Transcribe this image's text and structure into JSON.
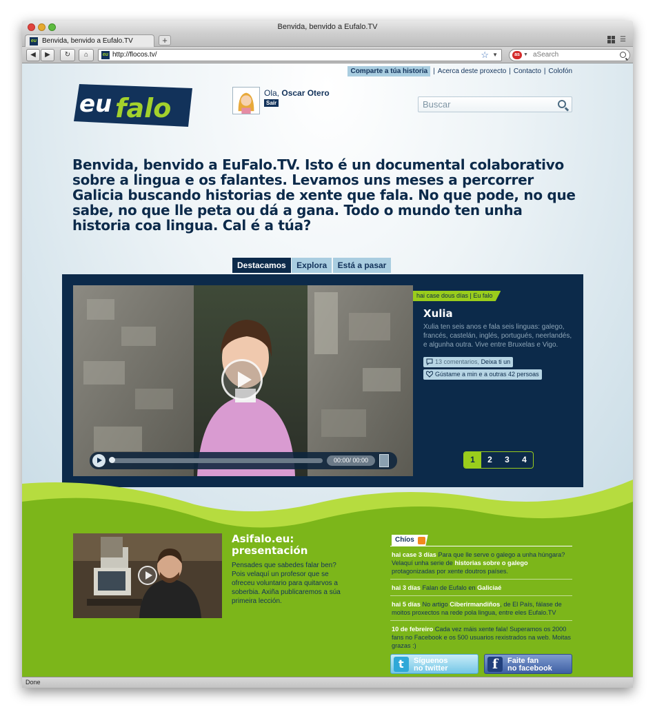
{
  "browser": {
    "window_title": "Benvida, benvido a Eufalo.TV",
    "tab_title": "Benvida, benvido a Eufalo.TV",
    "new_tab_label": "+",
    "url": "http://flocos.tv/",
    "search_placeholder": "aSearch",
    "search_badge": "as",
    "status": "Done",
    "favicon_text": "eu"
  },
  "topnav": {
    "items": [
      "Comparte a túa historia",
      "Acerca deste proxecto",
      "Contacto",
      "Colofón"
    ]
  },
  "logo": {
    "part1": "eu",
    "part2": "falo"
  },
  "user": {
    "greeting": "Ola,",
    "name": "Oscar Otero",
    "logout": "Saír"
  },
  "search": {
    "placeholder": "Buscar"
  },
  "intro": "Benvida, benvido a EuFalo.TV. Isto é un documental colaborativo sobre a lingua e os falantes. Levamos uns meses a percorrer Galicia buscando historias de xente que fala. No que pode, no que sabe, no que lle peta ou dá a gana. Todo o mundo ten unha historia coa lingua. Cal é a túa?",
  "tabs": [
    "Destacamos",
    "Explora",
    "Está a pasar"
  ],
  "featured": {
    "tag": "hai case dous días | Eu falo",
    "title": "Xulia",
    "description": "Xulia ten seis anos e fala seis linguas: galego, francés, castelán, inglés, portugués, neerlandés, e algunha outra. Vive entre Bruxelas e Vigo.",
    "comments_count": "13 comentarios,",
    "comments_cta": "Deixa ti un",
    "likes": "Gústame a min e a outras 42 persoas",
    "video_time": "00:00/ 00:00",
    "pager": [
      "1",
      "2",
      "3",
      "4"
    ],
    "video_progress": 0
  },
  "promo": {
    "title": "Asifalo.eu: presentación",
    "text": "Pensades que sabedes falar ben? Pois velaquí un profesor que se ofreceu voluntario para quitarvos a soberbia. Axiña publicaremos a súa primeira lección."
  },
  "chios": {
    "label": "Chíos",
    "items": [
      {
        "when": "hai case 3 días",
        "t1": "Para que lle serve o galego a unha húngara? Velaquí unha serie de",
        "b": "historias sobre o galego",
        "t2": "protagonizadas por xente doutros países."
      },
      {
        "when": "hai 3 días",
        "t1": "Falan de Eufalo en",
        "b": "Galiciaé",
        "t2": ""
      },
      {
        "when": "hai 5 días",
        "t1": "No artigo",
        "b": "Ciberirmandiños",
        "t2": ", de El País, fálase de moitos proxectos na rede pola lingua, entre eles Eufalo.TV"
      },
      {
        "when": "10 de febreiro",
        "t1": "Cada vez máis xente fala! Superamos os 2000 fans no Facebook e os 500 usuarios rexistrados na web. Moitas grazas :)",
        "b": "",
        "t2": ""
      }
    ]
  },
  "social": {
    "twitter_l1": "Síguenos",
    "twitter_l2": "no twitter",
    "facebook_l1": "Faite fan",
    "facebook_l2": "no facebook"
  }
}
